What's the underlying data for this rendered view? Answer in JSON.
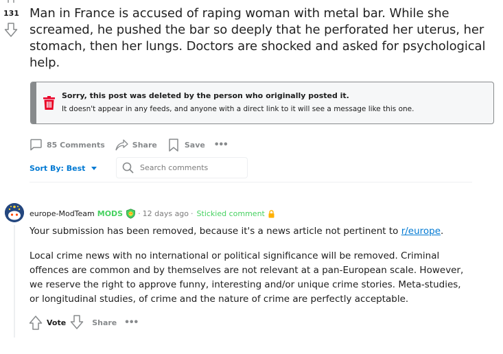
{
  "post": {
    "vote_count": "131",
    "title": "Man in France is accused of raping woman with metal bar. While she screamed, he pushed the bar so deeply that he perforated her uterus, her stomach, then her lungs. Doctors are shocked and asked for psychological help."
  },
  "deleted_notice": {
    "title": "Sorry, this post was deleted by the person who originally posted it.",
    "subtitle": "It doesn't appear in any feeds, and anyone with a direct link to it will see a message like this one.",
    "icon": "trash-icon",
    "accent": "#ea0027"
  },
  "actions": {
    "comments_label": "85 Comments",
    "share_label": "Share",
    "save_label": "Save"
  },
  "sort": {
    "label": "Sort By: Best"
  },
  "search": {
    "placeholder": "Search comments"
  },
  "comment": {
    "author": "europe-ModTeam",
    "mods_badge": "MODS",
    "time": "12 days ago",
    "stickied": "Stickied comment",
    "body_p1_prefix": "Your submission has been removed, because it's a news article not pertinent to ",
    "body_p1_link": "r/europe",
    "body_p1_suffix": ".",
    "body_p2": "Local crime news with no international or political significance will be removed. Criminal offences are common and by themselves are not relevant at a pan-European scale. However, we reserve the right to approve funny, interesting and/or unique crime stories. Meta-studies, or longitudinal studies, of crime and the nature of crime are perfectly acceptable.",
    "vote_label": "Vote",
    "share_label": "Share"
  },
  "colors": {
    "link": "#0079d3",
    "mod_green": "#46d160",
    "muted": "#878a8c"
  }
}
